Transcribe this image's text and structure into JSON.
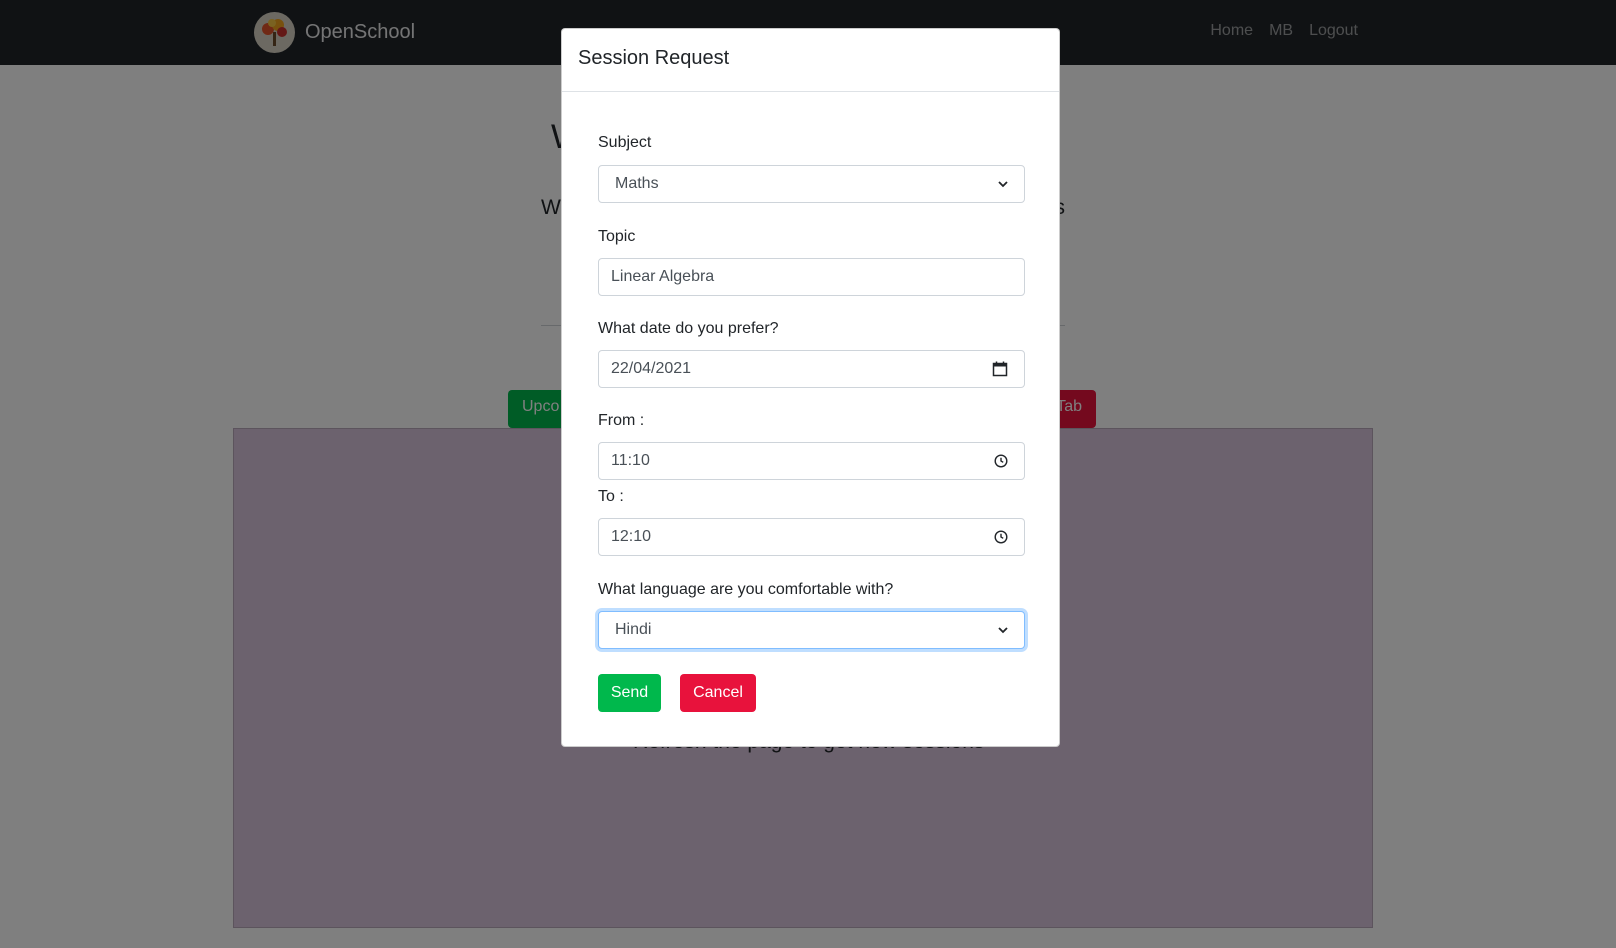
{
  "navbar": {
    "brand": "OpenSchool",
    "links": [
      "Home",
      "MB",
      "Logout"
    ]
  },
  "background": {
    "title_fragment": "W",
    "subtitle_left": "W",
    "subtitle_right": "s",
    "upcoming_button": "Upco",
    "tab_button": "Tab",
    "panel_text": "Refresh the page to get new sessions"
  },
  "modal": {
    "title": "Session Request",
    "subject": {
      "label": "Subject",
      "value": "Maths"
    },
    "topic": {
      "label": "Topic",
      "value": "Linear Algebra"
    },
    "date": {
      "label": "What date do you prefer?",
      "value": "22/04/2021"
    },
    "from": {
      "label": "From :",
      "value": "11:10"
    },
    "to": {
      "label": "To :",
      "value": "12:10"
    },
    "language": {
      "label": "What language are you comfortable with?",
      "value": "Hindi"
    },
    "send_label": "Send",
    "cancel_label": "Cancel"
  },
  "colors": {
    "navbar": "#212529",
    "success": "#00b84c",
    "danger": "#e8123c"
  }
}
